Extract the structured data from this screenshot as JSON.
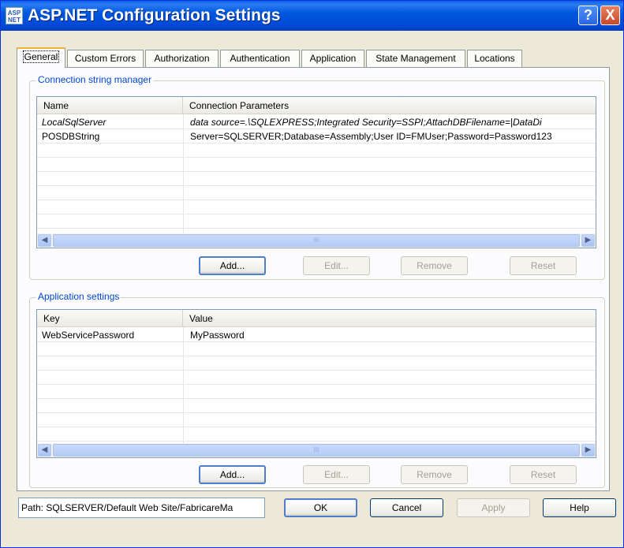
{
  "window": {
    "title": "ASP.NET Configuration Settings",
    "logo_text": "ASP NET",
    "help_glyph": "?",
    "close_glyph": "X"
  },
  "tabs": [
    {
      "label": "General",
      "active": true
    },
    {
      "label": "Custom Errors"
    },
    {
      "label": "Authorization"
    },
    {
      "label": "Authentication"
    },
    {
      "label": "Application"
    },
    {
      "label": "State Management"
    },
    {
      "label": "Locations"
    }
  ],
  "connection_strings": {
    "group_title": "Connection string manager",
    "columns": [
      "Name",
      "Connection Parameters"
    ],
    "rows": [
      {
        "name": "LocalSqlServer",
        "params": "data source=.\\SQLEXPRESS;Integrated Security=SSPI;AttachDBFilename=|DataDi",
        "inherited": true
      },
      {
        "name": "POSDBString",
        "params": "Server=SQLSERVER;Database=Assembly;User ID=FMUser;Password=Password123",
        "inherited": false
      }
    ],
    "buttons": {
      "add": "Add...",
      "edit": "Edit...",
      "remove": "Remove",
      "reset": "Reset"
    }
  },
  "app_settings": {
    "group_title": "Application settings",
    "columns": [
      "Key",
      "Value"
    ],
    "rows": [
      {
        "key": "WebServicePassword",
        "value": "MyPassword"
      }
    ],
    "buttons": {
      "add": "Add...",
      "edit": "Edit...",
      "remove": "Remove",
      "reset": "Reset"
    }
  },
  "footer": {
    "path": "Path: SQLSERVER/Default Web Site/FabricareMa",
    "ok": "OK",
    "cancel": "Cancel",
    "apply": "Apply",
    "help": "Help"
  },
  "scroll_thumb_grip": "III"
}
